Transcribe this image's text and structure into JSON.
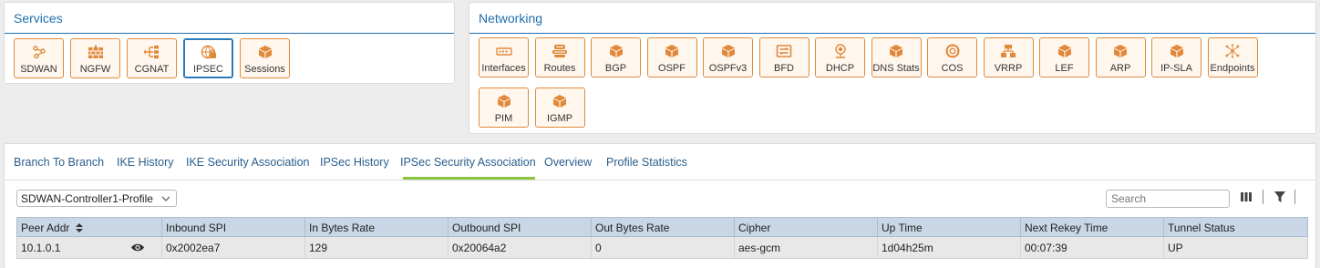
{
  "services": {
    "title": "Services",
    "tiles": [
      {
        "label": "SDWAN",
        "icon": "sdwan-icon"
      },
      {
        "label": "NGFW",
        "icon": "firewall-icon"
      },
      {
        "label": "CGNAT",
        "icon": "cgnat-icon"
      },
      {
        "label": "IPSEC",
        "icon": "ipsec-icon",
        "active": true
      },
      {
        "label": "Sessions",
        "icon": "cube-icon"
      }
    ]
  },
  "networking": {
    "title": "Networking",
    "tiles": [
      {
        "label": "Interfaces",
        "icon": "interfaces-icon"
      },
      {
        "label": "Routes",
        "icon": "routes-icon"
      },
      {
        "label": "BGP",
        "icon": "cube-icon"
      },
      {
        "label": "OSPF",
        "icon": "cube-icon"
      },
      {
        "label": "OSPFv3",
        "icon": "cube-icon"
      },
      {
        "label": "BFD",
        "icon": "bfd-icon"
      },
      {
        "label": "DHCP",
        "icon": "dhcp-icon"
      },
      {
        "label": "DNS Stats",
        "icon": "cube-icon"
      },
      {
        "label": "COS",
        "icon": "cos-icon"
      },
      {
        "label": "VRRP",
        "icon": "vrrp-icon"
      },
      {
        "label": "LEF",
        "icon": "cube-icon"
      },
      {
        "label": "ARP",
        "icon": "cube-icon"
      },
      {
        "label": "IP-SLA",
        "icon": "cube-icon"
      },
      {
        "label": "Endpoints",
        "icon": "endpoints-icon"
      },
      {
        "label": "PIM",
        "icon": "cube-icon"
      },
      {
        "label": "IGMP",
        "icon": "cube-icon"
      }
    ]
  },
  "tabs": [
    {
      "label": "Branch To Branch"
    },
    {
      "label": "IKE History"
    },
    {
      "label": "IKE Security Association"
    },
    {
      "label": "IPSec History"
    },
    {
      "label": "IPSec Security Association",
      "active": true
    },
    {
      "label": "Overview"
    },
    {
      "label": "Profile Statistics"
    }
  ],
  "profile_select": {
    "value": "SDWAN-Controller1-Profile"
  },
  "search": {
    "placeholder": "Search"
  },
  "table": {
    "columns": [
      "Peer Addr",
      "Inbound SPI",
      "In Bytes Rate",
      "Outbound SPI",
      "Out Bytes Rate",
      "Cipher",
      "Up Time",
      "Next Rekey Time",
      "Tunnel Status"
    ],
    "rows": [
      [
        "10.1.0.1",
        "0x2002ea7",
        "129",
        "0x20064a2",
        "0",
        "aes-gcm",
        "1d04h25m",
        "00:07:39",
        "UP"
      ]
    ]
  },
  "colors": {
    "accent_orange": "#e0893a",
    "link_blue": "#2b5d8c",
    "title_blue": "#1f6fae",
    "active_tab": "#8cc63f"
  }
}
